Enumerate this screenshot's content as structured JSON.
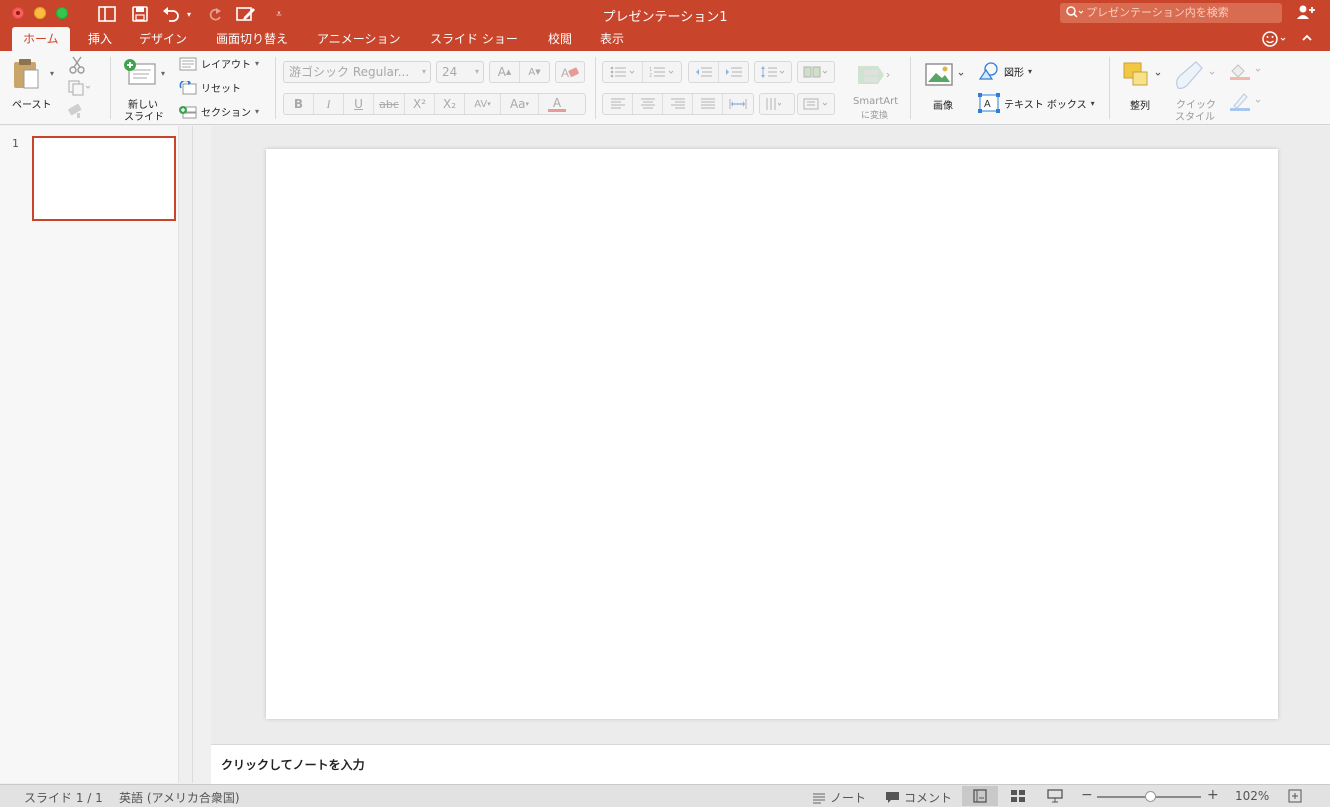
{
  "window": {
    "title": "プレゼンテーション1"
  },
  "search": {
    "placeholder": "プレゼンテーション内を検索"
  },
  "tabs": [
    {
      "label": "ホーム",
      "active": true
    },
    {
      "label": "挿入"
    },
    {
      "label": "デザイン"
    },
    {
      "label": "画面切り替え"
    },
    {
      "label": "アニメーション"
    },
    {
      "label": "スライド ショー"
    },
    {
      "label": "校閲"
    },
    {
      "label": "表示"
    }
  ],
  "ribbon": {
    "paste_label": "ペースト",
    "new_slide_label_1": "新しい",
    "new_slide_label_2": "スライド",
    "layout_label": "レイアウト",
    "reset_label": "リセット",
    "section_label": "セクション",
    "font_name": "游ゴシック Regular...",
    "font_size": "24",
    "bold": "B",
    "italic": "I",
    "underline": "U",
    "strikethrough": "abc",
    "superscript": "X²",
    "subscript": "X₂",
    "char_spacing": "AV",
    "change_case": "Aa",
    "font_color": "A",
    "smartart_label_1": "SmartArt",
    "smartart_label_2": "に変換",
    "picture_label": "画像",
    "shape_label": "図形",
    "textbox_label": "テキスト ボックス",
    "arrange_label": "整列",
    "quick_style_label_1": "クイック",
    "quick_style_label_2": "スタイル"
  },
  "slides": [
    {
      "number": "1"
    }
  ],
  "notes": {
    "placeholder": "クリックしてノートを入力"
  },
  "status": {
    "slide_info": "スライド 1 / 1",
    "language": "英語 (アメリカ合衆国)",
    "notes_label": "ノート",
    "comments_label": "コメント",
    "zoom_level": "102%",
    "zoom_fraction": 0.51
  },
  "colors": {
    "accent": "#c8452c",
    "ribbon_bg": "#f7f7f7",
    "canvas_bg": "#ececec"
  }
}
